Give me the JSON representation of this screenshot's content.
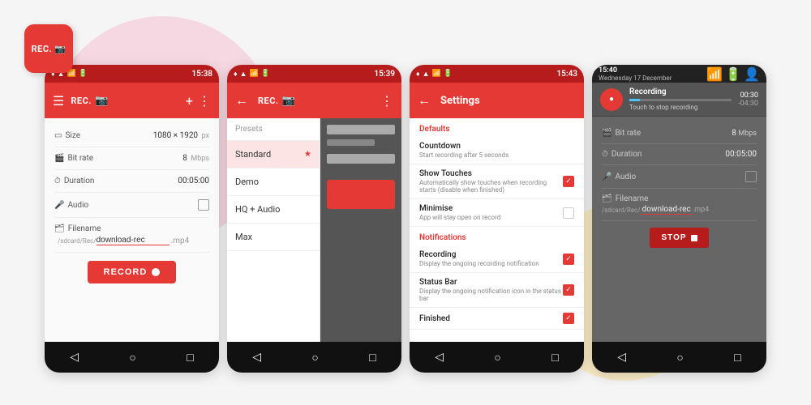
{
  "app": {
    "icon_label": "REC.",
    "bg_color": "#e53935"
  },
  "phone1": {
    "status": {
      "time": "15:38",
      "icons": "♦ ▲ ▼ ◆ ▌▌"
    },
    "toolbar": {
      "title": "REC.",
      "menu_icon": "☰",
      "add_icon": "+",
      "more_icon": "⋮"
    },
    "fields": {
      "size_label": "Size",
      "size_value": "1080 × 1920",
      "size_unit": "px",
      "bitrate_label": "Bit rate",
      "bitrate_value": "8",
      "bitrate_unit": "Mbps",
      "duration_label": "Duration",
      "duration_value": "00:05:00",
      "audio_label": "Audio",
      "filename_label": "Filename",
      "filename_path": "/sdcard/Rec/",
      "filename_value": "download-rec",
      "filename_ext": ".mp4"
    },
    "record_btn": "RECORD",
    "nav": {
      "back": "◁",
      "home": "○",
      "recent": "□"
    }
  },
  "phone2": {
    "status": {
      "time": "15:39",
      "icons": "♦ ▲ ▼ ◆ ▌▌"
    },
    "toolbar": {
      "back": "←",
      "title": "REC.",
      "more_icon": "⋮"
    },
    "presets": {
      "header": "Presets",
      "items": [
        {
          "label": "Standard",
          "selected": true
        },
        {
          "label": "Demo",
          "selected": false
        },
        {
          "label": "HQ + Audio",
          "selected": false
        },
        {
          "label": "Max",
          "selected": false
        }
      ]
    },
    "nav": {
      "back": "◁",
      "home": "○",
      "recent": "□"
    }
  },
  "phone3": {
    "status": {
      "time": "15:43",
      "icons": "♦ ▲ ▼ ◆ ▌▌"
    },
    "toolbar": {
      "back": "←",
      "title": "Settings"
    },
    "settings": {
      "sections": [
        {
          "title": "Defaults",
          "items": [
            {
              "title": "Countdown",
              "sub": "Start recording after 5 seconds",
              "checked": false,
              "type": "none"
            },
            {
              "title": "Show Touches",
              "sub": "Automatically show touches when recording starts (disable when finished)",
              "checked": true,
              "type": "checkbox"
            },
            {
              "title": "Minimise",
              "sub": "App will stay open on record",
              "checked": false,
              "type": "checkbox"
            }
          ]
        },
        {
          "title": "Notifications",
          "items": [
            {
              "title": "Recording",
              "sub": "Display the ongoing recording notification",
              "checked": true,
              "type": "checkbox"
            },
            {
              "title": "Status Bar",
              "sub": "Display the ongoing notification icon in the status bar",
              "checked": true,
              "type": "checkbox"
            },
            {
              "title": "Finished",
              "sub": "",
              "checked": true,
              "type": "checkbox"
            }
          ]
        }
      ]
    },
    "nav": {
      "back": "◁",
      "home": "○",
      "recent": "□"
    }
  },
  "phone4": {
    "status": {
      "time": "15:40",
      "date": "Wednesday 17 December",
      "icons": "▼ ▌▌ 👤"
    },
    "notification": {
      "title": "Recording",
      "sub": "Touch to stop recording",
      "timer": "00:30",
      "timer_neg": "-04:30"
    },
    "fields": {
      "bitrate_label": "Bit rate",
      "bitrate_value": "8",
      "bitrate_unit": "Mbps",
      "duration_label": "Duration",
      "duration_value": "00:05:00",
      "audio_label": "Audio",
      "filename_label": "Filename",
      "filename_path": "/sdcard/Rec/",
      "filename_value": "download-rec",
      "filename_ext": ".mp4"
    },
    "stop_btn": "STOP",
    "nav": {
      "back": "◁",
      "home": "○",
      "recent": "□"
    }
  }
}
